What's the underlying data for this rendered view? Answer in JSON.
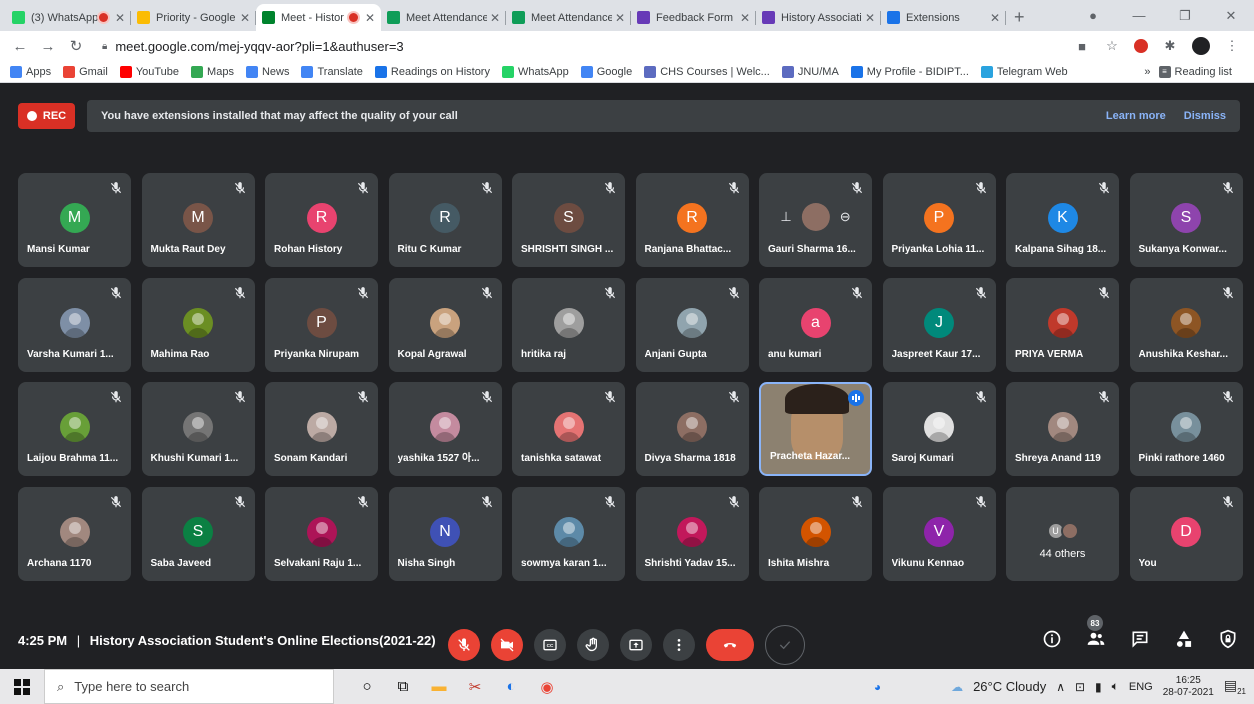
{
  "browser": {
    "tabs": [
      {
        "title": "(3) WhatsApp",
        "favicon_color": "#25d366",
        "recording": true,
        "active": false
      },
      {
        "title": "Priority - Google",
        "favicon_color": "#fbbc04",
        "recording": false,
        "active": false
      },
      {
        "title": "Meet - Histor",
        "favicon_color": "#00832d",
        "recording": true,
        "active": true
      },
      {
        "title": "Meet Attendance",
        "favicon_color": "#0f9d58",
        "recording": false,
        "active": false
      },
      {
        "title": "Meet Attendance",
        "favicon_color": "#0f9d58",
        "recording": false,
        "active": false
      },
      {
        "title": "Feedback Form :",
        "favicon_color": "#673ab7",
        "recording": false,
        "active": false
      },
      {
        "title": "History Associatio",
        "favicon_color": "#673ab7",
        "recording": false,
        "active": false
      },
      {
        "title": "Extensions",
        "favicon_color": "#1a73e8",
        "recording": false,
        "active": false
      }
    ],
    "url": "meet.google.com/mej-yqqv-aor?pli=1&authuser=3",
    "bookmarks": [
      {
        "label": "Apps",
        "color": "#4285f4"
      },
      {
        "label": "Gmail",
        "color": "#ea4335"
      },
      {
        "label": "YouTube",
        "color": "#ff0000"
      },
      {
        "label": "Maps",
        "color": "#34a853"
      },
      {
        "label": "News",
        "color": "#4285f4"
      },
      {
        "label": "Translate",
        "color": "#4285f4"
      },
      {
        "label": "Readings on History",
        "color": "#1a73e8"
      },
      {
        "label": "WhatsApp",
        "color": "#25d366"
      },
      {
        "label": "Google",
        "color": "#4285f4"
      },
      {
        "label": "CHS Courses | Welc...",
        "color": "#5c6bc0"
      },
      {
        "label": "JNU/MA",
        "color": "#5c6bc0"
      },
      {
        "label": "My Profile - BIDIPT...",
        "color": "#1a73e8"
      },
      {
        "label": "Telegram Web",
        "color": "#2aa3df"
      }
    ],
    "bookmarks_more": "»",
    "reading_list": "Reading list"
  },
  "meet": {
    "rec_label": "REC",
    "banner_text": "You have extensions installed that may affect the quality of your call",
    "learn_more": "Learn more",
    "dismiss": "Dismiss",
    "participants": [
      {
        "name": "Mansi Kumar",
        "initial": "M",
        "color": "#34a853"
      },
      {
        "name": "Mukta Raut Dey",
        "initial": "M",
        "color": "#795548"
      },
      {
        "name": "Rohan History",
        "initial": "R",
        "color": "#e8436f"
      },
      {
        "name": "Ritu C Kumar",
        "initial": "R",
        "color": "#455a64"
      },
      {
        "name": "SHRISHTI SINGH ...",
        "initial": "S",
        "color": "#6d4c41"
      },
      {
        "name": "Ranjana Bhattac...",
        "initial": "R",
        "color": "#f4731f"
      },
      {
        "name": "Gauri Sharma 16...",
        "initial": "",
        "color": "#8d6e63",
        "pinned": true
      },
      {
        "name": "Priyanka Lohia 11...",
        "initial": "P",
        "color": "#f4731f"
      },
      {
        "name": "Kalpana Sihag 18...",
        "initial": "K",
        "color": "#1e88e5"
      },
      {
        "name": "Sukanya Konwar...",
        "initial": "S",
        "color": "#8e44ad"
      },
      {
        "name": "Varsha Kumari 1...",
        "initial": "",
        "color": "#7e8fa6"
      },
      {
        "name": "Mahima Rao",
        "initial": "",
        "color": "#6b8e23"
      },
      {
        "name": "Priyanka Nirupam",
        "initial": "P",
        "color": "#6d4c41"
      },
      {
        "name": "Kopal Agrawal",
        "initial": "",
        "color": "#c9a27e"
      },
      {
        "name": "hritika raj",
        "initial": "",
        "color": "#9e9e9e"
      },
      {
        "name": "Anjani Gupta",
        "initial": "",
        "color": "#90a4ae"
      },
      {
        "name": "anu kumari",
        "initial": "a",
        "color": "#e8436f"
      },
      {
        "name": "Jaspreet Kaur 17...",
        "initial": "J",
        "color": "#00897b"
      },
      {
        "name": "PRIYA VERMA",
        "initial": "",
        "color": "#c0392b"
      },
      {
        "name": "Anushika Keshar...",
        "initial": "",
        "color": "#8d5524"
      },
      {
        "name": "Laijou Brahma 11...",
        "initial": "",
        "color": "#689f38"
      },
      {
        "name": "Khushi Kumari 1...",
        "initial": "",
        "color": "#757575"
      },
      {
        "name": "Sonam Kandari",
        "initial": "",
        "color": "#bcaaa4"
      },
      {
        "name": "yashika 1527 아...",
        "initial": "",
        "color": "#c48b9f"
      },
      {
        "name": "tanishka satawat",
        "initial": "",
        "color": "#e57373"
      },
      {
        "name": "Divya Sharma 1818",
        "initial": "",
        "color": "#8d6e63"
      },
      {
        "name": "Pracheta Hazar...",
        "initial": "",
        "color": "#8c8170",
        "speaking": true
      },
      {
        "name": "Saroj Kumari",
        "initial": "",
        "color": "#e0e0e0"
      },
      {
        "name": "Shreya Anand 119",
        "initial": "",
        "color": "#a1887f"
      },
      {
        "name": "Pinki rathore 1460",
        "initial": "",
        "color": "#78909c"
      },
      {
        "name": "Archana 1170",
        "initial": "",
        "color": "#a1887f"
      },
      {
        "name": "Saba Javeed",
        "initial": "S",
        "color": "#0b8043"
      },
      {
        "name": "Selvakani Raju 1...",
        "initial": "",
        "color": "#ad1457"
      },
      {
        "name": "Nisha Singh",
        "initial": "N",
        "color": "#3f51b5"
      },
      {
        "name": "sowmya karan 1...",
        "initial": "",
        "color": "#5d8aa8"
      },
      {
        "name": "Shrishti Yadav 15...",
        "initial": "",
        "color": "#c2185b"
      },
      {
        "name": "Ishita Mishra",
        "initial": "",
        "color": "#d35400"
      },
      {
        "name": "Vikunu Kennao",
        "initial": "V",
        "color": "#8e24aa"
      },
      {
        "name": "44 others",
        "initial": "U",
        "color": "#9e9e9e",
        "others": true
      },
      {
        "name": "You",
        "initial": "D",
        "color": "#e8436f"
      }
    ],
    "time": "4:25 PM",
    "separator": "|",
    "meeting_title": "History Association Student's Online Elections(2021-22)",
    "participant_count": "83"
  },
  "taskbar": {
    "search_placeholder": "Type here to search",
    "weather": "26°C Cloudy",
    "language": "ENG",
    "time": "16:25",
    "date": "28-07-2021",
    "notifications": "21"
  }
}
